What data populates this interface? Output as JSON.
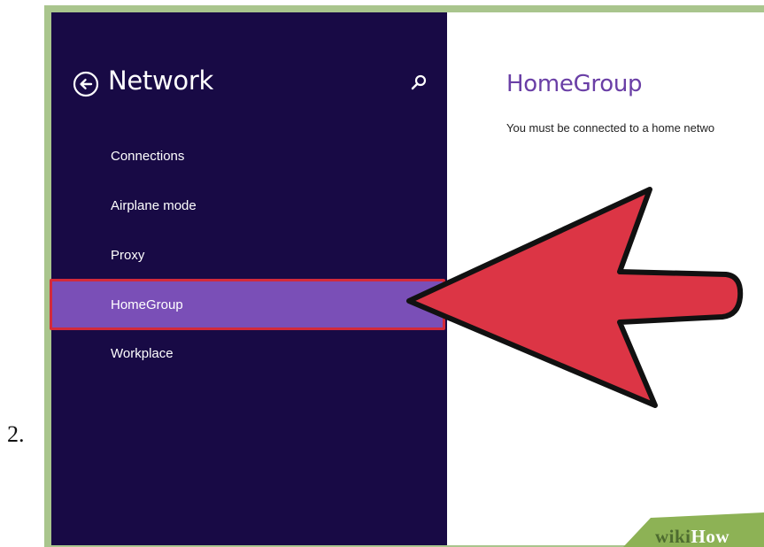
{
  "step_number": "2.",
  "sidebar": {
    "title": "Network",
    "back_icon": "back-arrow-circle-icon",
    "search_icon": "search-icon",
    "items": [
      {
        "label": "Connections",
        "selected": false
      },
      {
        "label": "Airplane mode",
        "selected": false
      },
      {
        "label": "Proxy",
        "selected": false
      },
      {
        "label": "HomeGroup",
        "selected": true
      },
      {
        "label": "Workplace",
        "selected": false
      }
    ]
  },
  "content": {
    "title": "HomeGroup",
    "message": "You must be connected to a home netwo"
  },
  "annotation": {
    "icon": "red-pointer-arrow-icon",
    "color": "#dc3545"
  },
  "watermark": {
    "wiki": "wiki",
    "how": "How"
  },
  "colors": {
    "sidebar_bg": "#180a45",
    "selected_bg": "#7a4fb7",
    "selected_border": "#d32a3a",
    "title_accent": "#6a3fa6",
    "frame": "#a9c58d"
  }
}
